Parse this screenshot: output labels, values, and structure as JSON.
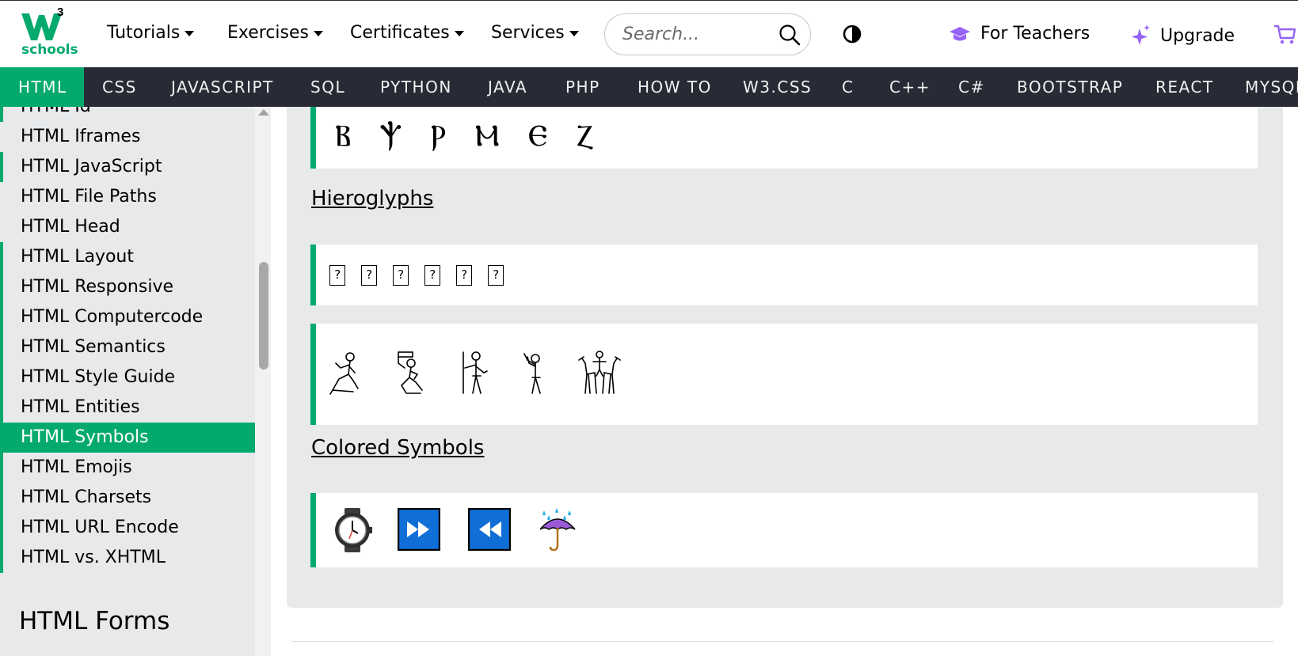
{
  "header": {
    "logo_text": "schools",
    "logo_superscript": "3",
    "menus": [
      {
        "label": "Tutorials"
      },
      {
        "label": "Exercises"
      },
      {
        "label": "Certificates"
      },
      {
        "label": "Services"
      }
    ],
    "search": {
      "placeholder": "Search...",
      "value": ""
    },
    "for_teachers": "For Teachers",
    "upgrade": "Upgrade",
    "accent_color": "#04aa6d",
    "icon_purple": "#9763f6"
  },
  "subnav": {
    "items": [
      "HTML",
      "CSS",
      "JAVASCRIPT",
      "SQL",
      "PYTHON",
      "JAVA",
      "PHP",
      "HOW TO",
      "W3.CSS",
      "C",
      "C++",
      "C#",
      "BOOTSTRAP",
      "REACT",
      "MYSQL"
    ],
    "active": "HTML",
    "background": "#282a35"
  },
  "sidebar": {
    "items": [
      "HTML Id",
      "HTML Iframes",
      "HTML JavaScript",
      "HTML File Paths",
      "HTML Head",
      "HTML Layout",
      "HTML Responsive",
      "HTML Computercode",
      "HTML Semantics",
      "HTML Style Guide",
      "HTML Entities",
      "HTML Symbols",
      "HTML Emojis",
      "HTML Charsets",
      "HTML URL Encode",
      "HTML vs. XHTML"
    ],
    "active": "HTML Symbols",
    "heading": "HTML Forms"
  },
  "content": {
    "coptic_text": "Ⲃ Ⲯ Ⲣ Ⲙ Ⲉ Ⲍ",
    "hieroglyphs_heading": "Hieroglyphs",
    "missing_glyph_count_label": "?",
    "colored_symbols_heading": "Colored Symbols",
    "hieroglyph_icons": [
      "kneeling-man-icon",
      "man-with-basket-icon",
      "man-with-staff-icon",
      "man-praying-icon",
      "man-with-animals-icon"
    ],
    "colored_symbol_icons": [
      "watch-icon",
      "fast-forward-icon",
      "fast-rewind-icon",
      "umbrella-rain-icon"
    ],
    "colored_symbol_blue": "#0f6fd6"
  }
}
